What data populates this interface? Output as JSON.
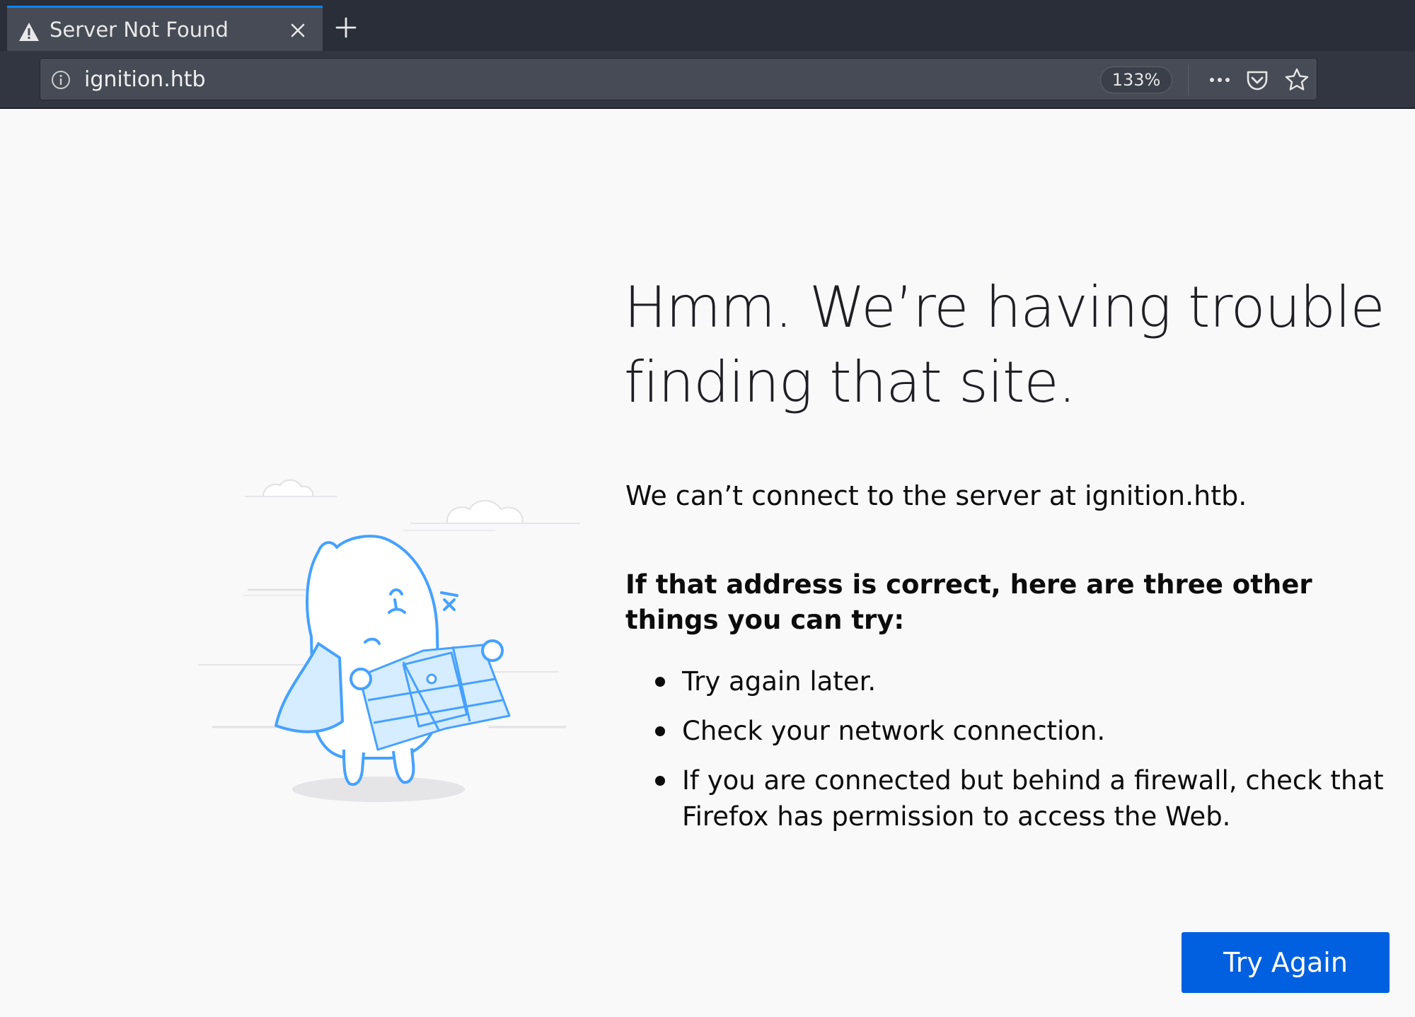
{
  "tab": {
    "title": "Server Not Found",
    "icon": "warning-icon",
    "active": true
  },
  "toolbar": {
    "url": "ignition.htb",
    "zoom": "133%",
    "icons": [
      "info-icon",
      "more-icon",
      "pocket-icon",
      "bookmark-star-icon"
    ]
  },
  "error_page": {
    "heading": "Hmm. We’re having trouble finding that site.",
    "intro": "We can’t connect to the server at ignition.htb.",
    "list_title": "If that address is correct, here are three other things you can try:",
    "tips": [
      "Try again later.",
      "Check your network connection.",
      "If you are connected but behind a firewall, check that Firefox has permission to access the Web."
    ],
    "button_label": "Try Again",
    "illustration": "lost-monster-with-map"
  },
  "colors": {
    "tabstrip": "#2a2e38",
    "active_tab": "#474b55",
    "tab_accent": "#0a84ff",
    "urlbar": "#474b55",
    "page_bg": "#f9f9fa",
    "button": "#0060df",
    "illustration_line": "#45a1ff",
    "illustration_fill": "#d6ecff"
  }
}
